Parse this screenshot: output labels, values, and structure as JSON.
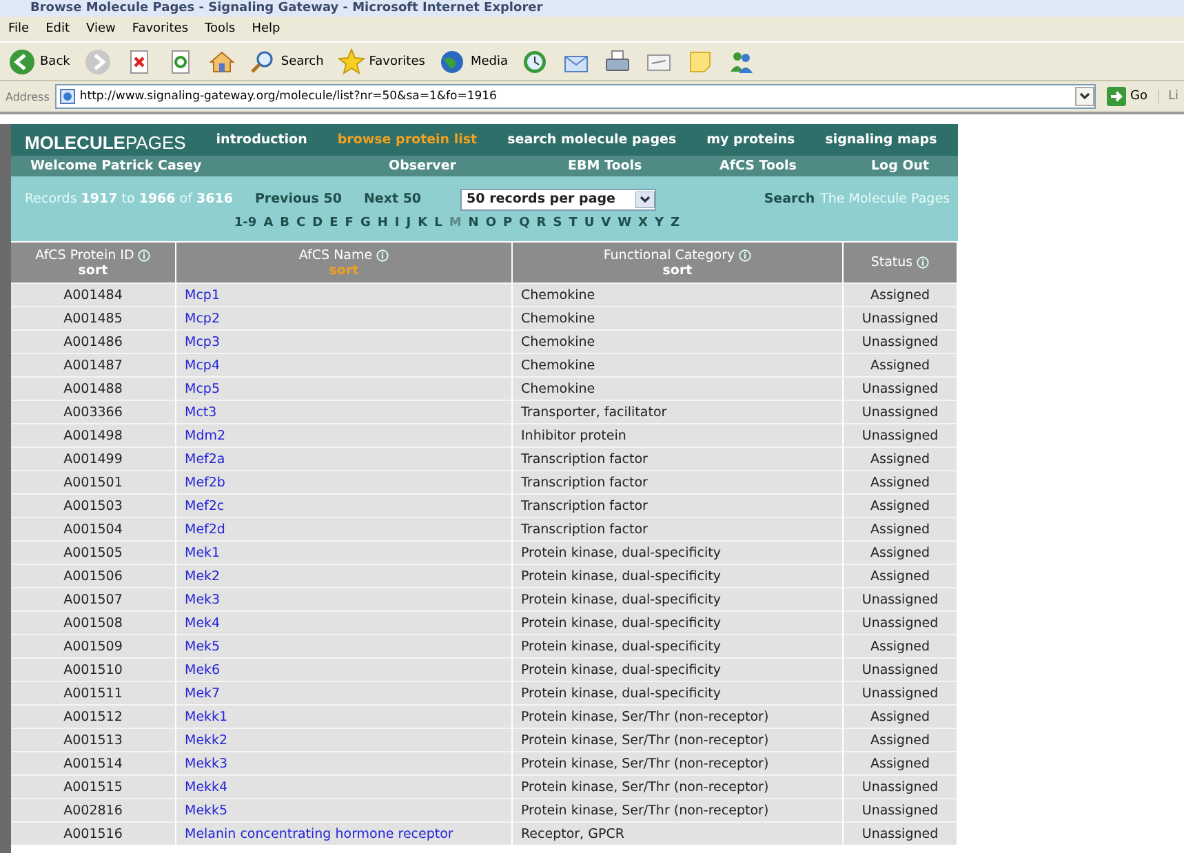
{
  "window": {
    "title": "Browse Molecule Pages - Signaling Gateway - Microsoft Internet Explorer"
  },
  "menu": [
    "File",
    "Edit",
    "View",
    "Favorites",
    "Tools",
    "Help"
  ],
  "toolbar": [
    {
      "kind": "back",
      "label": "Back"
    },
    {
      "kind": "forward"
    },
    {
      "kind": "stop"
    },
    {
      "kind": "refresh"
    },
    {
      "kind": "home"
    },
    {
      "kind": "search",
      "label": "Search"
    },
    {
      "kind": "favorites",
      "label": "Favorites"
    },
    {
      "kind": "media",
      "label": "Media"
    },
    {
      "kind": "history"
    },
    {
      "kind": "mail"
    },
    {
      "kind": "print"
    },
    {
      "kind": "edit"
    },
    {
      "kind": "note"
    },
    {
      "kind": "messenger"
    }
  ],
  "address": {
    "label": "Address",
    "url": "http://www.signaling-gateway.org/molecule/list?nr=50&sa=1&fo=1916",
    "go": "Go",
    "links": "Li"
  },
  "site": {
    "logo_bold": "MOLECULE",
    "logo_light": "PAGES",
    "nav": [
      {
        "label": "introduction",
        "selected": false
      },
      {
        "label": "browse protein list",
        "selected": true
      },
      {
        "label": "search molecule pages",
        "selected": false
      },
      {
        "label": "my proteins",
        "selected": false
      },
      {
        "label": "signaling maps",
        "selected": false
      }
    ],
    "user_bar": [
      "Welcome Patrick Casey",
      "Observer",
      "EBM Tools",
      "AfCS Tools",
      "Log Out"
    ],
    "records": {
      "summary": "Records **1917** to **1966** of **3616**",
      "previous": "Previous 50",
      "next": "Next 50",
      "per_page": "50 records per page",
      "search_label": "Search",
      "search_text": "The Molecule Pages"
    },
    "letters": [
      {
        "label": "1-9",
        "selected": false
      },
      {
        "label": "A",
        "selected": false
      },
      {
        "label": "B",
        "selected": false
      },
      {
        "label": "C",
        "selected": false
      },
      {
        "label": "D",
        "selected": false
      },
      {
        "label": "E",
        "selected": false
      },
      {
        "label": "F",
        "selected": false
      },
      {
        "label": "G",
        "selected": false
      },
      {
        "label": "H",
        "selected": false
      },
      {
        "label": "I",
        "selected": false
      },
      {
        "label": "J",
        "selected": false
      },
      {
        "label": "K",
        "selected": false
      },
      {
        "label": "L",
        "selected": false
      },
      {
        "label": "M",
        "selected": true
      },
      {
        "label": "N",
        "selected": false
      },
      {
        "label": "O",
        "selected": false
      },
      {
        "label": "P",
        "selected": false
      },
      {
        "label": "Q",
        "selected": false
      },
      {
        "label": "R",
        "selected": false
      },
      {
        "label": "S",
        "selected": false
      },
      {
        "label": "T",
        "selected": false
      },
      {
        "label": "U",
        "selected": false
      },
      {
        "label": "V",
        "selected": false
      },
      {
        "label": "W",
        "selected": false
      },
      {
        "label": "X",
        "selected": false
      },
      {
        "label": "Y",
        "selected": false
      },
      {
        "label": "Z",
        "selected": false
      }
    ]
  },
  "table": {
    "columns": [
      {
        "label": "AfCS Protein ID",
        "sort": "sort",
        "selected": false
      },
      {
        "label": "AfCS Name",
        "sort": "sort",
        "selected": true
      },
      {
        "label": "Functional Category",
        "sort": "sort",
        "selected": false
      },
      {
        "label": "Status"
      }
    ],
    "rows": [
      {
        "id": "A001484",
        "name": "Mcp1",
        "category": "Chemokine",
        "status": "Assigned"
      },
      {
        "id": "A001485",
        "name": "Mcp2",
        "category": "Chemokine",
        "status": "Unassigned"
      },
      {
        "id": "A001486",
        "name": "Mcp3",
        "category": "Chemokine",
        "status": "Unassigned"
      },
      {
        "id": "A001487",
        "name": "Mcp4",
        "category": "Chemokine",
        "status": "Assigned"
      },
      {
        "id": "A001488",
        "name": "Mcp5",
        "category": "Chemokine",
        "status": "Unassigned"
      },
      {
        "id": "A003366",
        "name": "Mct3",
        "category": "Transporter, facilitator",
        "status": "Unassigned"
      },
      {
        "id": "A001498",
        "name": "Mdm2",
        "category": "Inhibitor protein",
        "status": "Unassigned"
      },
      {
        "id": "A001499",
        "name": "Mef2a",
        "category": "Transcription factor",
        "status": "Assigned"
      },
      {
        "id": "A001501",
        "name": "Mef2b",
        "category": "Transcription factor",
        "status": "Assigned"
      },
      {
        "id": "A001503",
        "name": "Mef2c",
        "category": "Transcription factor",
        "status": "Assigned"
      },
      {
        "id": "A001504",
        "name": "Mef2d",
        "category": "Transcription factor",
        "status": "Assigned"
      },
      {
        "id": "A001505",
        "name": "Mek1",
        "category": "Protein kinase, dual-specificity",
        "status": "Assigned"
      },
      {
        "id": "A001506",
        "name": "Mek2",
        "category": "Protein kinase, dual-specificity",
        "status": "Assigned"
      },
      {
        "id": "A001507",
        "name": "Mek3",
        "category": "Protein kinase, dual-specificity",
        "status": "Unassigned"
      },
      {
        "id": "A001508",
        "name": "Mek4",
        "category": "Protein kinase, dual-specificity",
        "status": "Unassigned"
      },
      {
        "id": "A001509",
        "name": "Mek5",
        "category": "Protein kinase, dual-specificity",
        "status": "Assigned"
      },
      {
        "id": "A001510",
        "name": "Mek6",
        "category": "Protein kinase, dual-specificity",
        "status": "Unassigned"
      },
      {
        "id": "A001511",
        "name": "Mek7",
        "category": "Protein kinase, dual-specificity",
        "status": "Unassigned"
      },
      {
        "id": "A001512",
        "name": "Mekk1",
        "category": "Protein kinase, Ser/Thr (non-receptor)",
        "status": "Assigned"
      },
      {
        "id": "A001513",
        "name": "Mekk2",
        "category": "Protein kinase, Ser/Thr (non-receptor)",
        "status": "Assigned"
      },
      {
        "id": "A001514",
        "name": "Mekk3",
        "category": "Protein kinase, Ser/Thr (non-receptor)",
        "status": "Assigned"
      },
      {
        "id": "A001515",
        "name": "Mekk4",
        "category": "Protein kinase, Ser/Thr (non-receptor)",
        "status": "Unassigned"
      },
      {
        "id": "A002816",
        "name": "Mekk5",
        "category": "Protein kinase, Ser/Thr (non-receptor)",
        "status": "Unassigned"
      },
      {
        "id": "A001516",
        "name": "Melanin concentrating hormone receptor",
        "category": "Receptor, GPCR",
        "status": "Unassigned"
      }
    ]
  }
}
